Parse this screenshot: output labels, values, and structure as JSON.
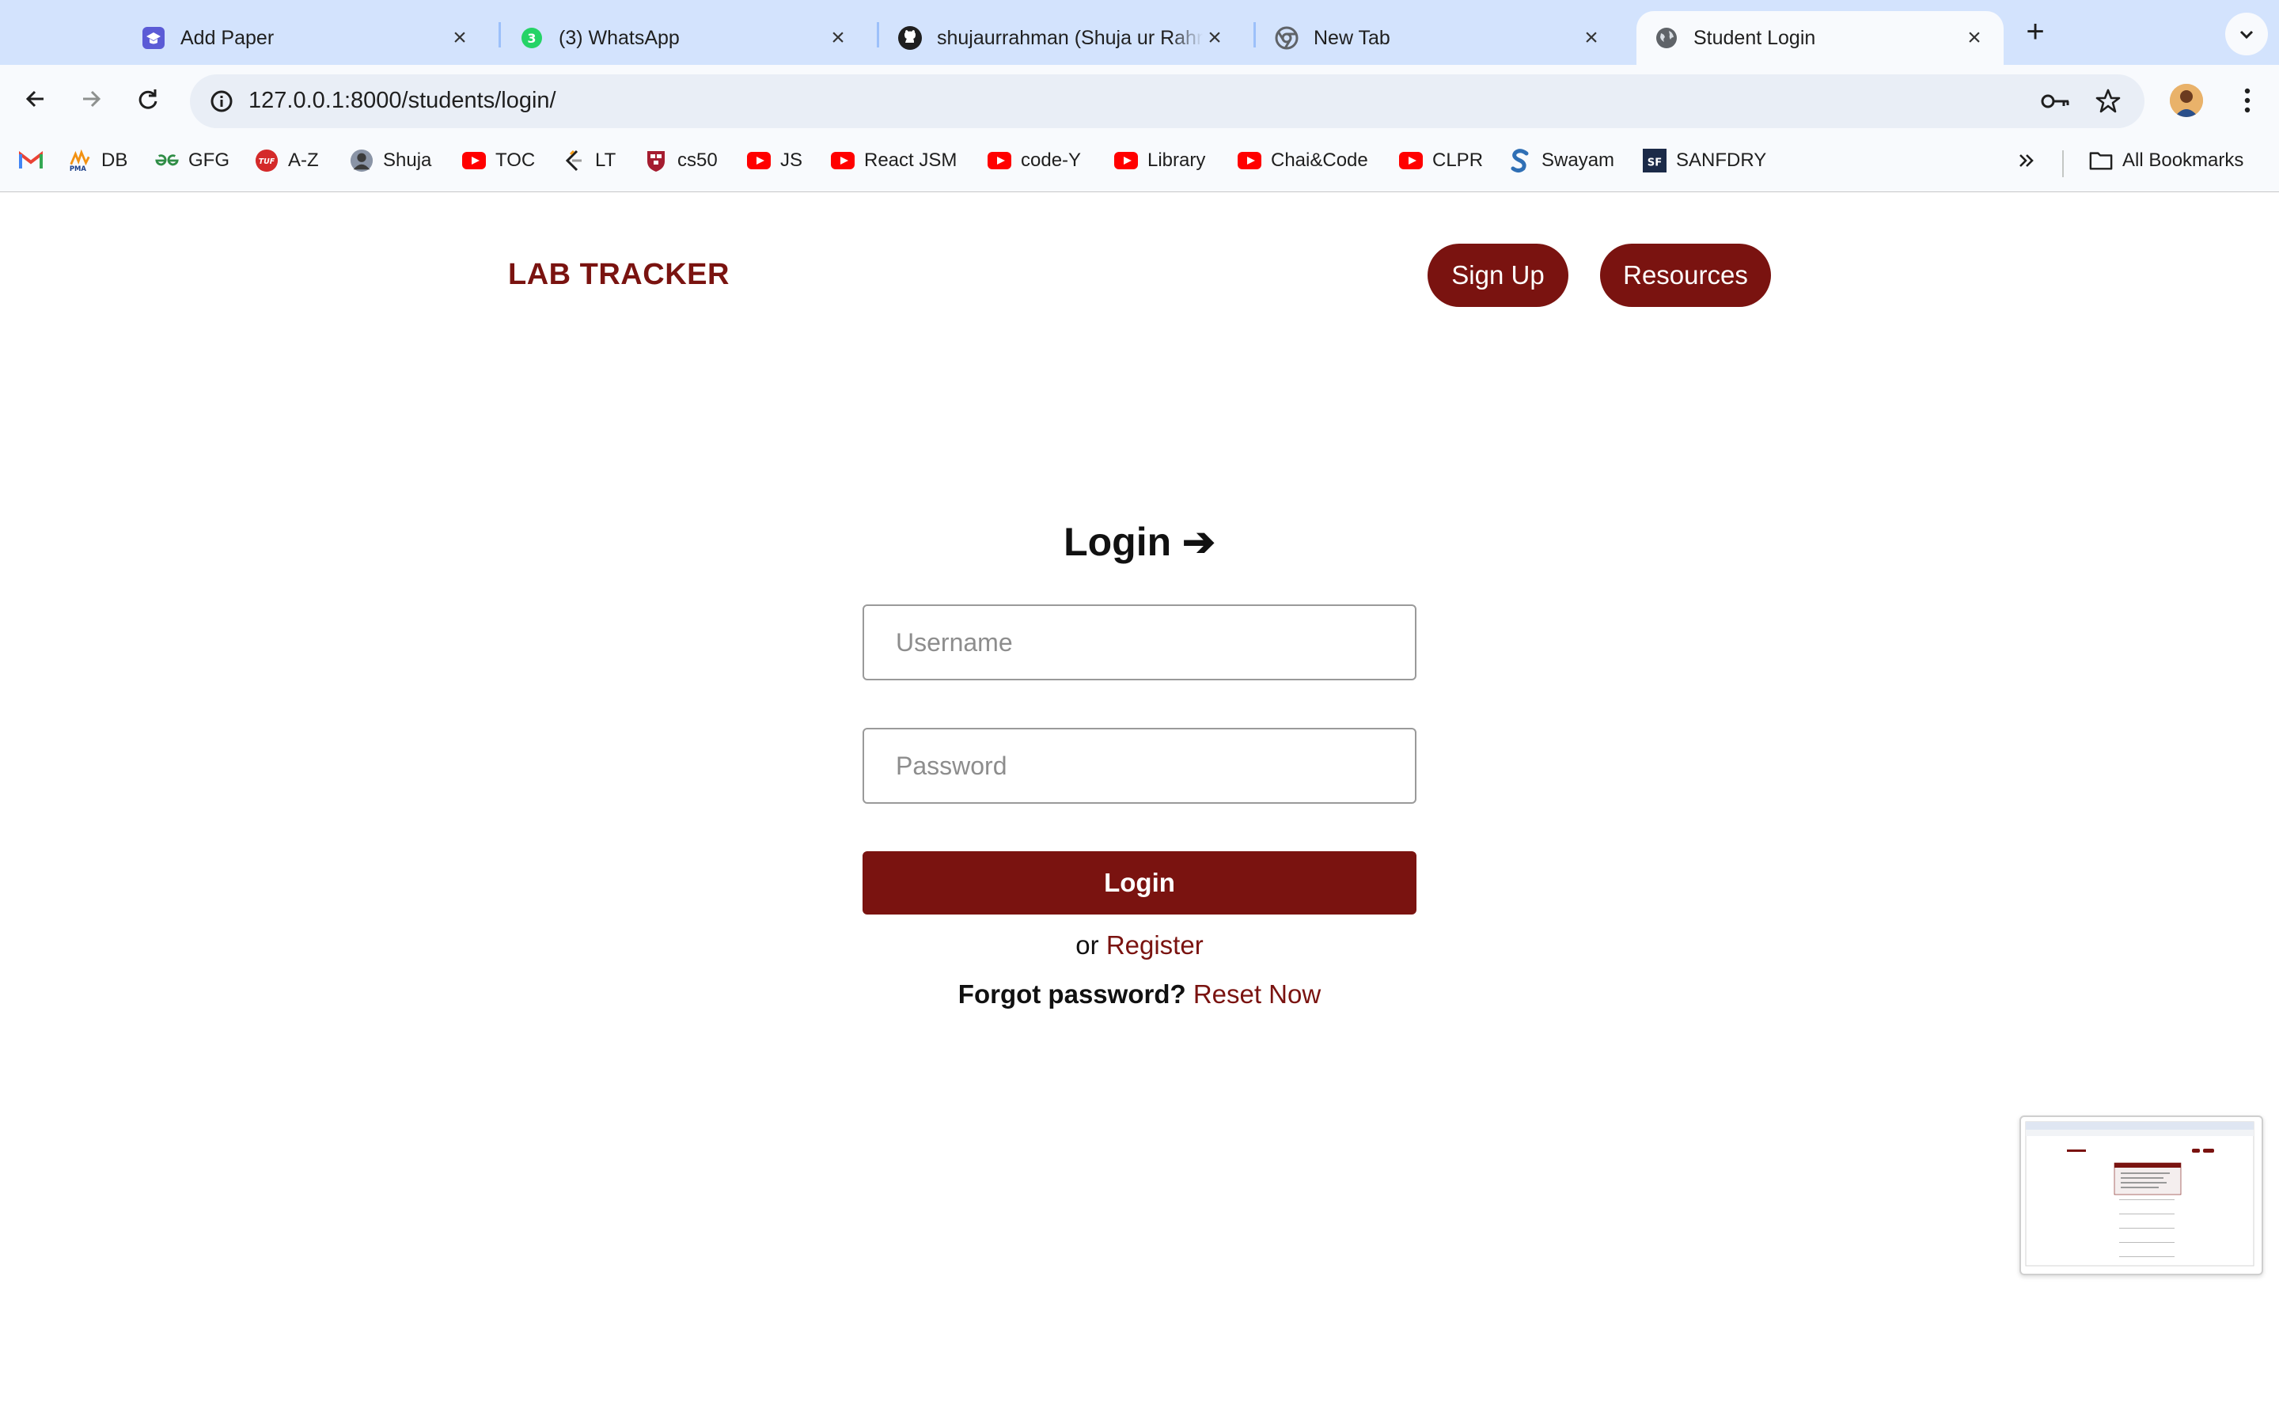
{
  "browser": {
    "tabs": [
      {
        "title": "Add Paper",
        "icon": "graduation-cap-icon"
      },
      {
        "title": "(3) WhatsApp",
        "icon": "whatsapp-icon",
        "badge": "3"
      },
      {
        "title": "shujaurrahman (Shuja ur Rahman)",
        "icon": "github-icon"
      },
      {
        "title": "New Tab",
        "icon": "chrome-icon"
      },
      {
        "title": "Student Login",
        "icon": "globe-icon",
        "active": true
      }
    ],
    "url": "127.0.0.1:8000/students/login/",
    "bookmarks": [
      "DB",
      "GFG",
      "A-Z",
      "Shuja",
      "TOC",
      "LT",
      "cs50",
      "JS",
      "React JSM",
      "code-Y",
      "Library",
      "Chai&Code",
      "CLPR",
      "Swayam",
      "SANFDRY"
    ],
    "all_bookmarks_label": "All Bookmarks"
  },
  "page": {
    "brand": "LAB TRACKER",
    "nav": {
      "signup": "Sign Up",
      "resources": "Resources"
    },
    "login": {
      "title": "Login ➔",
      "username_placeholder": "Username",
      "password_placeholder": "Password",
      "button": "Login",
      "or_text": "or",
      "register_link": "Register",
      "forgot_text": "Forgot password?",
      "reset_link": "Reset Now"
    }
  },
  "colors": {
    "accent": "#7a1310",
    "tabstrip": "#d3e3fd",
    "toolbar": "#f8fafd"
  }
}
